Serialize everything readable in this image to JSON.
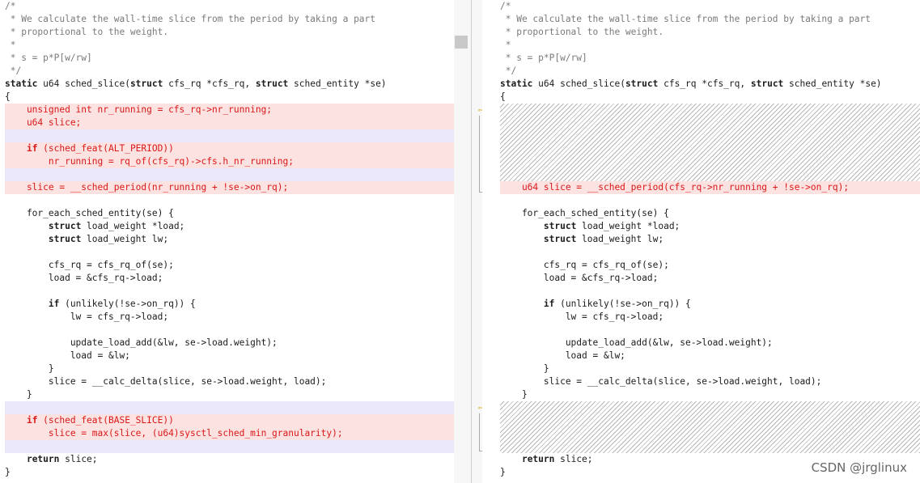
{
  "left": {
    "lines": [
      {
        "text": "/*",
        "kind": "comment"
      },
      {
        "text": " * We calculate the wall-time slice from the period by taking a part",
        "kind": "comment"
      },
      {
        "text": " * proportional to the weight.",
        "kind": "comment"
      },
      {
        "text": " *",
        "kind": "comment"
      },
      {
        "text": " * s = p*P[w/rw]",
        "kind": "comment"
      },
      {
        "text": " */",
        "kind": "comment"
      },
      {
        "text": "static u64 sched_slice(struct cfs_rq *cfs_rq, struct sched_entity *se)",
        "kind": "normal"
      },
      {
        "text": "{",
        "kind": "normal"
      },
      {
        "text": "    unsigned int nr_running = cfs_rq->nr_running;",
        "kind": "removed"
      },
      {
        "text": "    u64 slice;",
        "kind": "removed"
      },
      {
        "text": "",
        "kind": "gap"
      },
      {
        "text": "    if (sched_feat(ALT_PERIOD))",
        "kind": "removed"
      },
      {
        "text": "        nr_running = rq_of(cfs_rq)->cfs.h_nr_running;",
        "kind": "removed"
      },
      {
        "text": "",
        "kind": "gap"
      },
      {
        "text": "    slice = __sched_period(nr_running + !se->on_rq);",
        "kind": "removed"
      },
      {
        "text": "",
        "kind": "blank"
      },
      {
        "text": "    for_each_sched_entity(se) {",
        "kind": "normal"
      },
      {
        "text": "        struct load_weight *load;",
        "kind": "normal"
      },
      {
        "text": "        struct load_weight lw;",
        "kind": "normal"
      },
      {
        "text": "",
        "kind": "blank"
      },
      {
        "text": "        cfs_rq = cfs_rq_of(se);",
        "kind": "normal"
      },
      {
        "text": "        load = &cfs_rq->load;",
        "kind": "normal"
      },
      {
        "text": "",
        "kind": "blank"
      },
      {
        "text": "        if (unlikely(!se->on_rq)) {",
        "kind": "normal"
      },
      {
        "text": "            lw = cfs_rq->load;",
        "kind": "normal"
      },
      {
        "text": "",
        "kind": "blank"
      },
      {
        "text": "            update_load_add(&lw, se->load.weight);",
        "kind": "normal"
      },
      {
        "text": "            load = &lw;",
        "kind": "normal"
      },
      {
        "text": "        }",
        "kind": "normal"
      },
      {
        "text": "        slice = __calc_delta(slice, se->load.weight, load);",
        "kind": "normal"
      },
      {
        "text": "    }",
        "kind": "normal"
      },
      {
        "text": "",
        "kind": "gap"
      },
      {
        "text": "    if (sched_feat(BASE_SLICE))",
        "kind": "removed"
      },
      {
        "text": "        slice = max(slice, (u64)sysctl_sched_min_granularity);",
        "kind": "removed"
      },
      {
        "text": "",
        "kind": "gap"
      },
      {
        "text": "    return slice;",
        "kind": "normal"
      },
      {
        "text": "}",
        "kind": "normal"
      }
    ]
  },
  "right": {
    "lines": [
      {
        "row": 0,
        "text": "/*",
        "kind": "comment"
      },
      {
        "row": 1,
        "text": " * We calculate the wall-time slice from the period by taking a part",
        "kind": "comment"
      },
      {
        "row": 2,
        "text": " * proportional to the weight.",
        "kind": "comment"
      },
      {
        "row": 3,
        "text": " *",
        "kind": "comment"
      },
      {
        "row": 4,
        "text": " * s = p*P[w/rw]",
        "kind": "comment"
      },
      {
        "row": 5,
        "text": " */",
        "kind": "comment"
      },
      {
        "row": 6,
        "text": "static u64 sched_slice(struct cfs_rq *cfs_rq, struct sched_entity *se)",
        "kind": "normal"
      },
      {
        "row": 7,
        "text": "{",
        "kind": "normal"
      },
      {
        "row": 14,
        "text": "    u64 slice = __sched_period(cfs_rq->nr_running + !se->on_rq);",
        "kind": "removed"
      },
      {
        "row": 16,
        "text": "    for_each_sched_entity(se) {",
        "kind": "normal"
      },
      {
        "row": 17,
        "text": "        struct load_weight *load;",
        "kind": "normal"
      },
      {
        "row": 18,
        "text": "        struct load_weight lw;",
        "kind": "normal"
      },
      {
        "row": 20,
        "text": "        cfs_rq = cfs_rq_of(se);",
        "kind": "normal"
      },
      {
        "row": 21,
        "text": "        load = &cfs_rq->load;",
        "kind": "normal"
      },
      {
        "row": 23,
        "text": "        if (unlikely(!se->on_rq)) {",
        "kind": "normal"
      },
      {
        "row": 24,
        "text": "            lw = cfs_rq->load;",
        "kind": "normal"
      },
      {
        "row": 26,
        "text": "            update_load_add(&lw, se->load.weight);",
        "kind": "normal"
      },
      {
        "row": 27,
        "text": "            load = &lw;",
        "kind": "normal"
      },
      {
        "row": 28,
        "text": "        }",
        "kind": "normal"
      },
      {
        "row": 29,
        "text": "        slice = __calc_delta(slice, se->load.weight, load);",
        "kind": "normal"
      },
      {
        "row": 30,
        "text": "    }",
        "kind": "normal"
      },
      {
        "row": 35,
        "text": "    return slice;",
        "kind": "normal"
      },
      {
        "row": 36,
        "text": "}",
        "kind": "normal"
      }
    ]
  },
  "gutter": {
    "arrow_icon": "arrow-left-icon",
    "arrow_color": "#d6a100"
  },
  "colors": {
    "removed_bg": "#fde2e2",
    "removed_text": "#d91818",
    "gap_bg": "#ebe8fb"
  },
  "watermark": "CSDN @jrglinux"
}
